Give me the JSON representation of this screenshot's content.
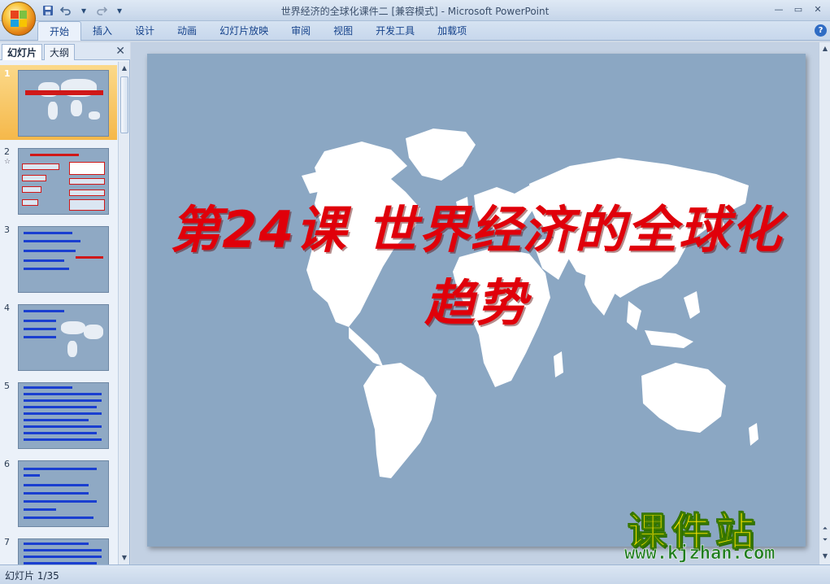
{
  "window": {
    "title": "世界经济的全球化课件二 [兼容模式] - Microsoft PowerPoint"
  },
  "qat": {
    "save_icon": "save-icon",
    "undo_icon": "undo-icon",
    "redo_icon": "redo-icon"
  },
  "ribbon": {
    "tabs": [
      "开始",
      "插入",
      "设计",
      "动画",
      "幻灯片放映",
      "审阅",
      "视图",
      "开发工具",
      "加载项"
    ],
    "active_tab": "开始"
  },
  "left_panel": {
    "tab_slides": "幻灯片",
    "tab_outline": "大纲",
    "thumbnails": [
      {
        "num": "1"
      },
      {
        "num": "2"
      },
      {
        "num": "3"
      },
      {
        "num": "4"
      },
      {
        "num": "5"
      },
      {
        "num": "6"
      },
      {
        "num": "7"
      }
    ]
  },
  "slide": {
    "title": "第24课  世界经济的全球化趋势",
    "background_color": "#8ba7c3",
    "title_color": "#e0000a"
  },
  "watermark": {
    "title": "课件站",
    "url": "www.kjzhan.com"
  },
  "status": {
    "slide_indicator": "幻灯片 1/35"
  }
}
